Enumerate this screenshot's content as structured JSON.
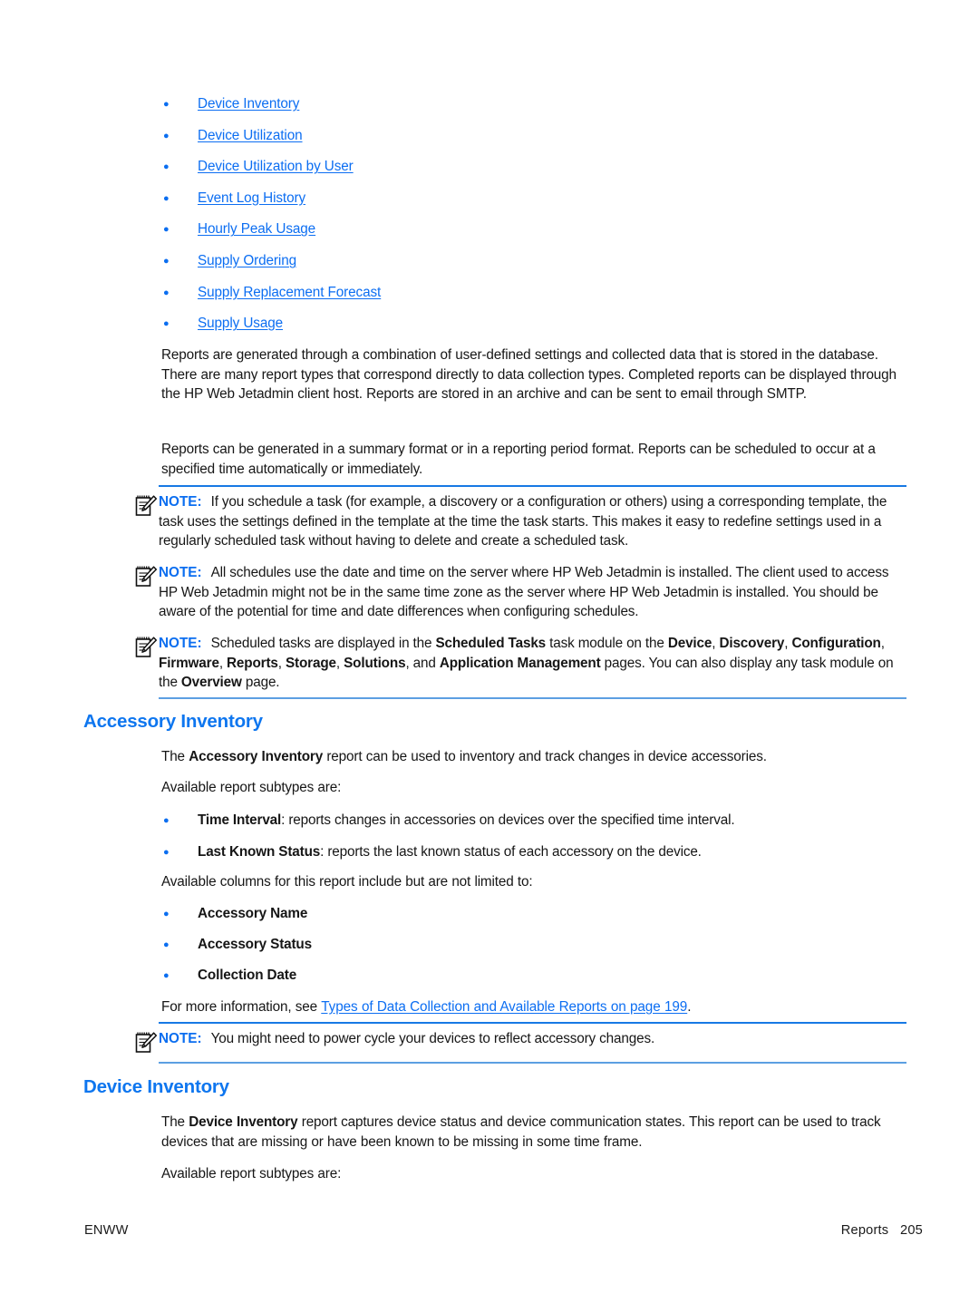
{
  "document": {
    "report_links": [
      "Device Inventory",
      "Device Utilization",
      "Device Utilization by User",
      "Event Log History",
      "Hourly Peak Usage",
      "Supply Ordering",
      "Supply Replacement Forecast",
      "Supply Usage"
    ],
    "paragraphs": {
      "reports_generated": "Reports are generated through a combination of user-defined settings and collected data that is stored in the database. There are many report types that correspond directly to data collection types. Completed reports can be displayed through the HP Web Jetadmin client host. Reports are stored in an archive and can be sent to email through SMTP.",
      "reports_format": "Reports can be generated in a summary format or in a reporting period format. Reports can be scheduled to occur at a specified time automatically or immediately."
    },
    "note_label": "NOTE:",
    "notes": {
      "schedule_task": "If you schedule a task (for example, a discovery or a configuration or others) using a corresponding template, the task uses the settings defined in the template at the time the task starts. This makes it easy to redefine settings used in a regularly scheduled task without having to delete and create a scheduled task.",
      "server_time": "All schedules use the date and time on the server where HP Web Jetadmin is installed. The client used to access HP Web Jetadmin might not be in the same time zone as the server where HP Web Jetadmin is installed. You should be aware of the potential for time and date differences when configuring schedules.",
      "scheduled_tasks": {
        "part1": "Scheduled tasks are displayed in the ",
        "bold1": "Scheduled Tasks",
        "part2": " task module on the ",
        "bold2": "Device",
        "sep2": ", ",
        "bold3": "Discovery",
        "sep3": ", ",
        "bold4": "Configuration",
        "sep4": ", ",
        "bold5": "Firmware",
        "sep5": ", ",
        "bold6": "Reports",
        "sep6": ", ",
        "bold7": "Storage",
        "sep7": ", ",
        "bold8": "Solutions",
        "sep8": ", and ",
        "bold9": "Application Management",
        "part3": " pages. You can also display any task module on the ",
        "bold10": "Overview",
        "part4": " page."
      },
      "power_cycle": "You might need to power cycle your devices to reflect accessory changes."
    },
    "accessory_inventory": {
      "heading": "Accessory Inventory",
      "intro_pre": "The ",
      "intro_bold": "Accessory Inventory",
      "intro_post": " report can be used to inventory and track changes in device accessories.",
      "subtypes_label": "Available report subtypes are:",
      "subtypes": [
        {
          "bold": "Time Interval",
          "rest": ": reports changes in accessories on devices over the specified time interval."
        },
        {
          "bold": "Last Known Status",
          "rest": ": reports the last known status of each accessory on the device."
        }
      ],
      "columns_label": "Available columns for this report include but are not limited to:",
      "columns": [
        "Accessory Name",
        "Accessory Status",
        "Collection Date"
      ],
      "more_info_pre": "For more information, see ",
      "more_info_link": "Types of Data Collection and Available Reports on page 199",
      "more_info_post": "."
    },
    "device_inventory": {
      "heading": "Device Inventory",
      "intro_pre": "The ",
      "intro_bold": "Device Inventory",
      "intro_post": " report captures device status and device communication states. This report can be used to track devices that are missing or have been known to be missing in some time frame.",
      "subtypes_label": "Available report subtypes are:"
    },
    "footer": {
      "left": "ENWW",
      "right": "Reports   205"
    },
    "colors": {
      "link": "#0c6ef2",
      "heading": "#0e76ef",
      "note_label": "#0b6ef0",
      "rule_top": "#1779e4",
      "rule_bottom": "#5c9fe2",
      "text": "#161616"
    }
  }
}
